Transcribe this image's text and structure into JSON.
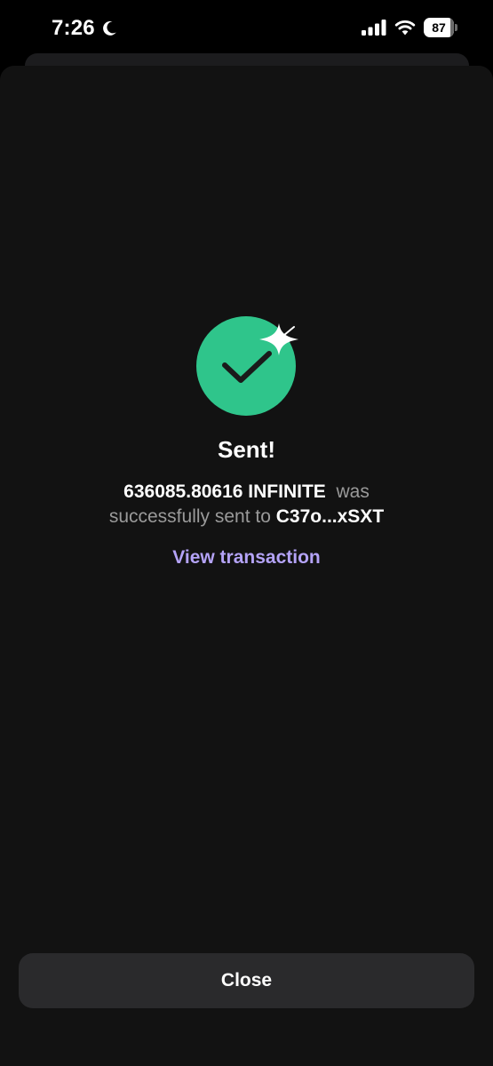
{
  "status_bar": {
    "time": "7:26",
    "battery_percent": "87",
    "battery_level": 0.87
  },
  "success": {
    "title": "Sent!",
    "amount": "636085.80616 INFINITE",
    "was": "was",
    "sent_to": "successfully sent to",
    "address": "C37o...xSXT",
    "view_link": "View transaction"
  },
  "footer": {
    "close_label": "Close"
  },
  "colors": {
    "success_green": "#2fc58b",
    "link_purple": "#b4a3f7",
    "sheet_bg": "#121212",
    "button_bg": "#2a2a2c"
  }
}
